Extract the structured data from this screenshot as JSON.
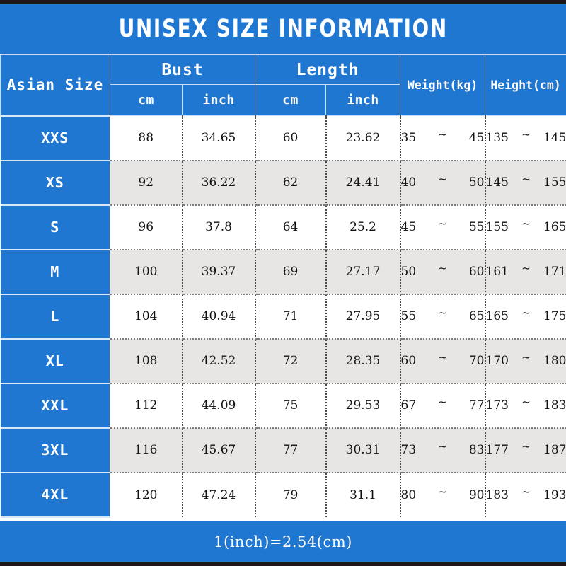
{
  "title": "UNISEX SIZE INFORMATION",
  "footer_note": "1(inch)=2.54(cm)",
  "colors": {
    "brand_blue": "#2077d2",
    "header_text": "#ffffff",
    "row_odd_bg": "#ffffff",
    "row_even_bg": "#e7e6e4",
    "grid_dotted": "#4a4a4a",
    "edge_band": "#1a1a1a"
  },
  "header": {
    "size_column": "Asian Size",
    "groups": [
      {
        "label": "Bust",
        "sub": [
          "cm",
          "inch"
        ]
      },
      {
        "label": "Length",
        "sub": [
          "cm",
          "inch"
        ]
      }
    ],
    "weight": "Weight(kg)",
    "height": "Height(cm)",
    "range_separator": "~"
  },
  "chart_data": {
    "type": "table",
    "title": "UNISEX SIZE INFORMATION",
    "columns": [
      "Asian Size",
      "Bust cm",
      "Bust inch",
      "Length cm",
      "Length inch",
      "Weight(kg)",
      "Height(cm)"
    ],
    "rows": [
      {
        "size": "XXS",
        "bust_cm": "88",
        "bust_inch": "34.65",
        "length_cm": "60",
        "length_inch": "23.62",
        "weight_min": "35",
        "weight_max": "45",
        "height_min": "135",
        "height_max": "145"
      },
      {
        "size": "XS",
        "bust_cm": "92",
        "bust_inch": "36.22",
        "length_cm": "62",
        "length_inch": "24.41",
        "weight_min": "40",
        "weight_max": "50",
        "height_min": "145",
        "height_max": "155"
      },
      {
        "size": "S",
        "bust_cm": "96",
        "bust_inch": "37.8",
        "length_cm": "64",
        "length_inch": "25.2",
        "weight_min": "45",
        "weight_max": "55",
        "height_min": "155",
        "height_max": "165"
      },
      {
        "size": "M",
        "bust_cm": "100",
        "bust_inch": "39.37",
        "length_cm": "69",
        "length_inch": "27.17",
        "weight_min": "50",
        "weight_max": "60",
        "height_min": "161",
        "height_max": "171"
      },
      {
        "size": "L",
        "bust_cm": "104",
        "bust_inch": "40.94",
        "length_cm": "71",
        "length_inch": "27.95",
        "weight_min": "55",
        "weight_max": "65",
        "height_min": "165",
        "height_max": "175"
      },
      {
        "size": "XL",
        "bust_cm": "108",
        "bust_inch": "42.52",
        "length_cm": "72",
        "length_inch": "28.35",
        "weight_min": "60",
        "weight_max": "70",
        "height_min": "170",
        "height_max": "180"
      },
      {
        "size": "XXL",
        "bust_cm": "112",
        "bust_inch": "44.09",
        "length_cm": "75",
        "length_inch": "29.53",
        "weight_min": "67",
        "weight_max": "77",
        "height_min": "173",
        "height_max": "183"
      },
      {
        "size": "3XL",
        "bust_cm": "116",
        "bust_inch": "45.67",
        "length_cm": "77",
        "length_inch": "30.31",
        "weight_min": "73",
        "weight_max": "83",
        "height_min": "177",
        "height_max": "187"
      },
      {
        "size": "4XL",
        "bust_cm": "120",
        "bust_inch": "47.24",
        "length_cm": "79",
        "length_inch": "31.1",
        "weight_min": "80",
        "weight_max": "90",
        "height_min": "183",
        "height_max": "193"
      }
    ],
    "conversion_note": "1(inch)=2.54(cm)"
  }
}
